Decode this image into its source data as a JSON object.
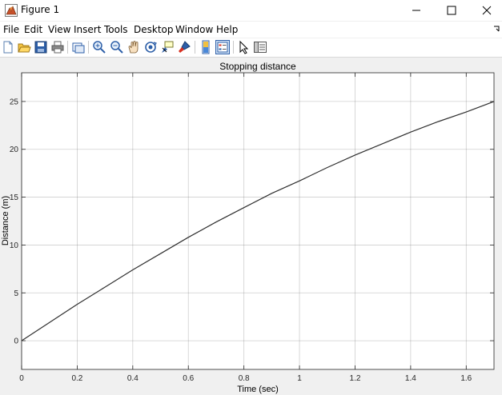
{
  "window": {
    "title": "Figure 1",
    "icons": {
      "app": "matlab-figure-icon",
      "minimize": "minimize-icon",
      "maximize": "maximize-icon",
      "close": "close-icon"
    }
  },
  "menu": {
    "items": [
      "File",
      "Edit",
      "View",
      "Insert",
      "Tools",
      "Desktop",
      "Window",
      "Help"
    ]
  },
  "toolbar": {
    "buttons": [
      "new-figure-icon",
      "open-file-icon",
      "save-icon",
      "print-icon",
      "link-plot-icon",
      "zoom-in-icon",
      "zoom-out-icon",
      "pan-icon",
      "rotate-3d-icon",
      "data-cursor-icon",
      "brush-icon",
      "insert-colorbar-icon",
      "insert-legend-icon",
      "edit-plot-icon",
      "property-inspector-icon"
    ]
  },
  "chart_data": {
    "type": "line",
    "title": "Stopping distance",
    "xlabel": "Time (sec)",
    "ylabel": "Distance (m)",
    "xlim": [
      0,
      1.7
    ],
    "ylim": [
      -3,
      28
    ],
    "xticks": [
      0,
      0.2,
      0.4,
      0.6,
      0.8,
      1,
      1.2,
      1.4,
      1.6
    ],
    "xtick_labels": [
      "0",
      "0.2",
      "0.4",
      "0.6",
      "0.8",
      "1",
      "1.2",
      "1.4",
      "1.6"
    ],
    "yticks": [
      0,
      5,
      10,
      15,
      20,
      25
    ],
    "ytick_labels": [
      "0",
      "5",
      "10",
      "15",
      "20",
      "25"
    ],
    "grid": true,
    "line_color": "#303030",
    "series": [
      {
        "x": [
          0,
          0.1,
          0.2,
          0.3,
          0.4,
          0.5,
          0.6,
          0.7,
          0.8,
          0.9,
          1.0,
          1.1,
          1.2,
          1.3,
          1.4,
          1.5,
          1.6,
          1.7
        ],
        "y": [
          0,
          1.9,
          3.8,
          5.6,
          7.4,
          9.1,
          10.8,
          12.4,
          13.9,
          15.4,
          16.7,
          18.1,
          19.4,
          20.6,
          21.8,
          22.9,
          23.9,
          25.0
        ]
      }
    ]
  }
}
